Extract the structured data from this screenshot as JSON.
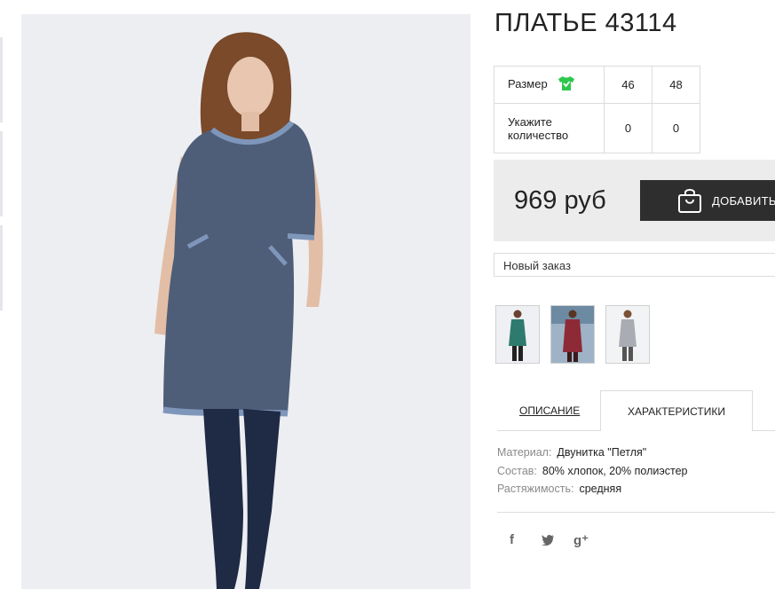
{
  "product": {
    "title": "ПЛАТЬЕ 43114"
  },
  "sizes": {
    "size_label": "Размер",
    "size_icon": "tshirt-check-icon",
    "qty_label_line1": "Укажите",
    "qty_label_line2": "количество",
    "columns": [
      {
        "size": "46",
        "qty": "0"
      },
      {
        "size": "48",
        "qty": "0"
      }
    ]
  },
  "purchase": {
    "price": "969 руб",
    "add_label": "ДОБАВИТЬ",
    "add_icon": "shopping-bag-icon",
    "order_select": "Новый заказ"
  },
  "thumbnails": [
    {
      "name": "dress-green",
      "color": "#2f7a6e"
    },
    {
      "name": "dress-burgundy",
      "color": "#8e2a36"
    },
    {
      "name": "dress-grey",
      "color": "#a9adb3"
    }
  ],
  "tabs": {
    "description": "ОПИСАНИЕ",
    "characteristics": "ХАРАКТЕРИСТИКИ"
  },
  "specs": [
    {
      "key": "Материал:",
      "value": "Двунитка \"Петля\""
    },
    {
      "key": "Состав:",
      "value": "80% хлопок, 20% полиэстер"
    },
    {
      "key": "Растяжимость:",
      "value": "средняя"
    }
  ],
  "social": {
    "facebook": "f",
    "twitter": "🐦",
    "gplus": "g⁺"
  },
  "colors": {
    "accent_dark": "#2e2e2e",
    "price_bg": "#ececec",
    "shirt_icon": "#2cc84d",
    "dress": "#4e5e78",
    "dress_trim": "#7f96bb"
  }
}
